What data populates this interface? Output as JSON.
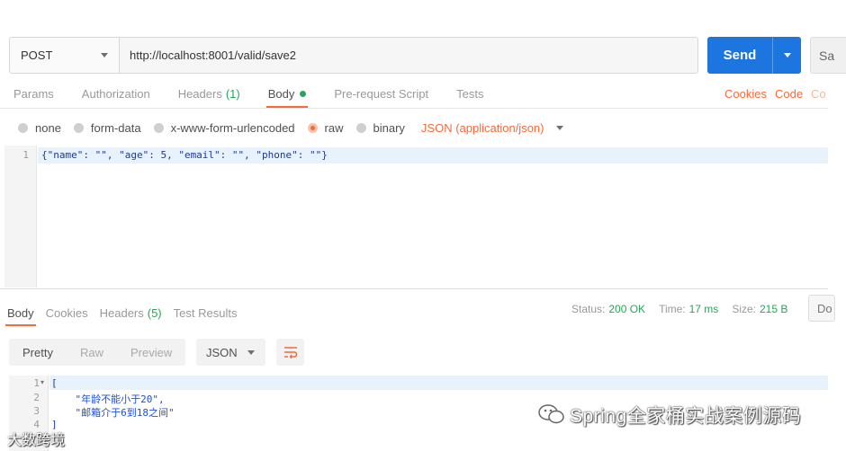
{
  "request": {
    "method": "POST",
    "url": "http://localhost:8001/valid/save2",
    "send_label": "Send",
    "save_label": "Sa"
  },
  "request_tabs": [
    {
      "label": "Params"
    },
    {
      "label": "Authorization"
    },
    {
      "label": "Headers",
      "count": "(1)"
    },
    {
      "label": "Body"
    },
    {
      "label": "Pre-request Script"
    },
    {
      "label": "Tests"
    }
  ],
  "right_links": [
    "Cookies",
    "Code",
    "Co"
  ],
  "body_types": [
    "none",
    "form-data",
    "x-www-form-urlencoded",
    "raw",
    "binary"
  ],
  "content_type": "JSON (application/json)",
  "request_body": {
    "line_number": "1",
    "code": "{\"name\": \"\", \"age\": 5, \"email\": \"\", \"phone\": \"\"}"
  },
  "response_tabs": [
    {
      "label": "Body"
    },
    {
      "label": "Cookies"
    },
    {
      "label": "Headers",
      "count": "(5)"
    },
    {
      "label": "Test Results"
    }
  ],
  "response_status": {
    "status_label": "Status:",
    "status_value": "200 OK",
    "time_label": "Time:",
    "time_value": "17 ms",
    "size_label": "Size:",
    "size_value": "215 B",
    "download_label": "Do"
  },
  "format_options": [
    "Pretty",
    "Raw",
    "Preview"
  ],
  "format_type": "JSON",
  "response_body": {
    "lines": [
      {
        "n": "1",
        "text": "["
      },
      {
        "n": "2",
        "text": "    \"年龄不能小于20\","
      },
      {
        "n": "3",
        "text": "    \"邮箱介于6到18之间\""
      },
      {
        "n": "4",
        "text": "]"
      }
    ]
  },
  "watermarks": {
    "brand": "Spring全家桶实战案例源码",
    "site": "大数跨境"
  },
  "colors": {
    "accent": "#f26b3a",
    "send": "#1d75e0",
    "success": "#26a65b"
  }
}
